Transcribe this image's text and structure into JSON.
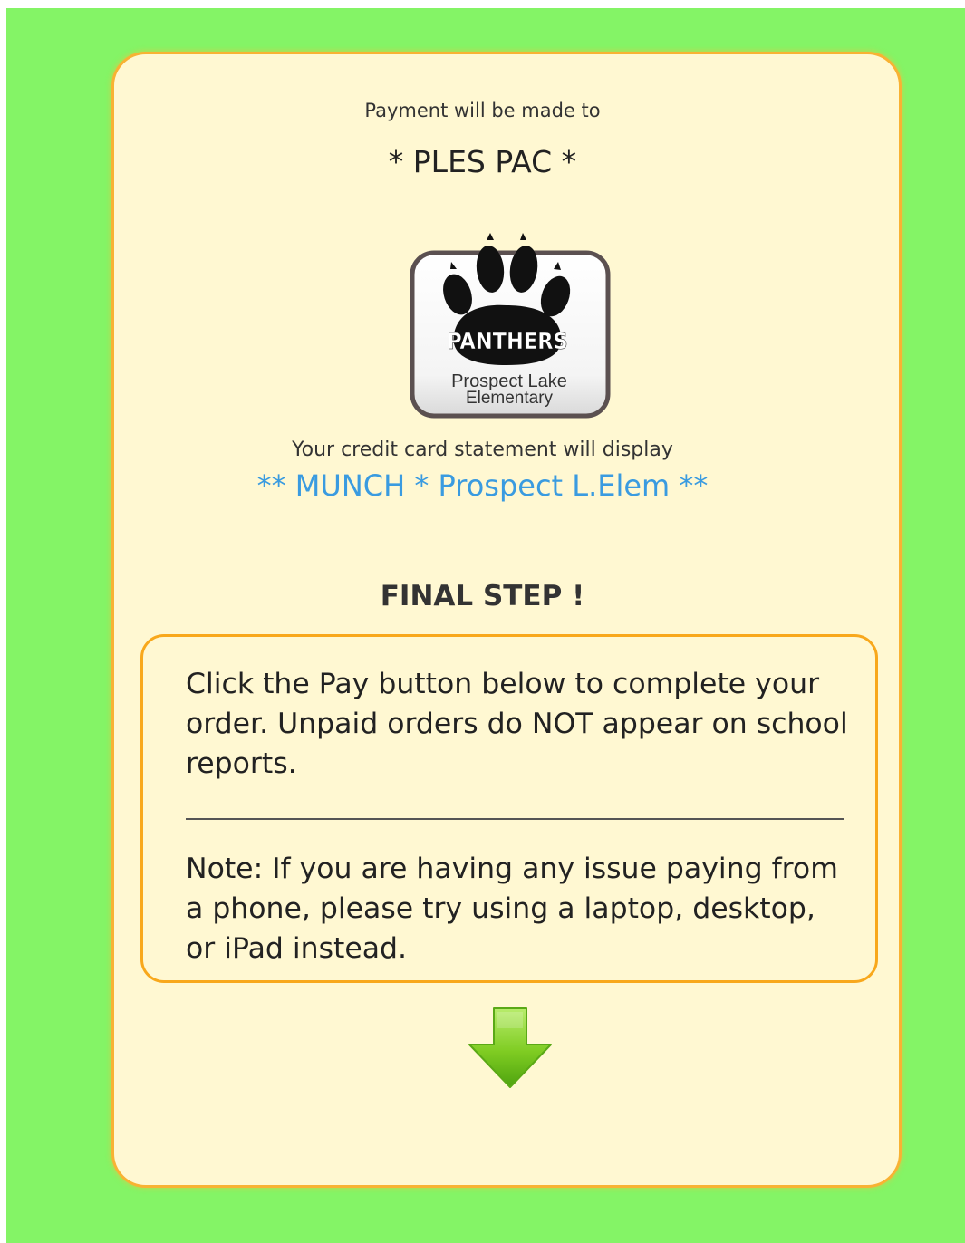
{
  "payment": {
    "label": "Payment will be made to",
    "payee": "* PLES PAC *"
  },
  "logo": {
    "icon": "panthers-paw-logo",
    "top_text": "PANTHERS",
    "line1": "Prospect Lake",
    "line2": "Elementary"
  },
  "statement": {
    "label": "Your credit card statement will display",
    "value": "** MUNCH * Prospect L.Elem **"
  },
  "final_step": {
    "heading": "FINAL STEP !",
    "instructions": "Click the Pay button below to complete your order. Unpaid orders do NOT appear on school reports.",
    "note": "Note: If you are having any issue paying from a phone, please try using a laptop, desktop, or iPad instead."
  },
  "arrow": {
    "icon": "down-arrow-icon",
    "color": "#6cc11a"
  },
  "colors": {
    "page_background": "#84f466",
    "card_background": "#fff8d2",
    "card_border": "#f8b233",
    "statement_text": "#3a9be0"
  }
}
